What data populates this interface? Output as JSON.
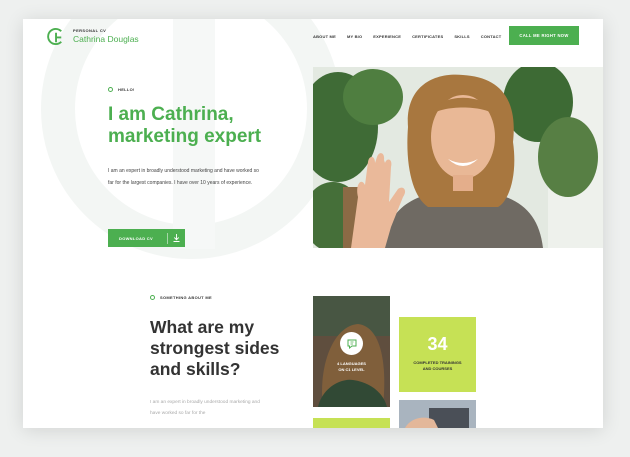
{
  "header": {
    "logo_small": "PERSONAL CV",
    "logo_name": "Cathrina Douglas",
    "nav": [
      "ABOUT ME",
      "MY BIO",
      "EXPERIENCE",
      "CERTIFICATES",
      "SKILLS",
      "CONTACT"
    ],
    "cta": "CALL ME RIGHT NOW"
  },
  "hero": {
    "eyebrow": "HELLO!",
    "title_line1": "I am Cathrina,",
    "title_line2": "marketing expert",
    "text": "I am an expert in broadly understood marketing and have worked so far for the largest companies. I have over 10 years of experience.",
    "download": "DOWNLOAD CV"
  },
  "about": {
    "eyebrow": "SOMETHING ABOUT ME",
    "title_line1": "What are my",
    "title_line2": "strongest sides",
    "title_line3": "and skills?",
    "text": "I am an expert in broadly understood marketing and have worked so far for the"
  },
  "skills": {
    "languages_line1": "4 LANGUAGES",
    "languages_line2": "ON C1 LEVEL",
    "count": "34",
    "count_label_line1": "COMPLETED TRAININGS",
    "count_label_line2": "AND COURSES"
  },
  "colors": {
    "accent": "#4caf50",
    "lime": "#c6e155"
  }
}
